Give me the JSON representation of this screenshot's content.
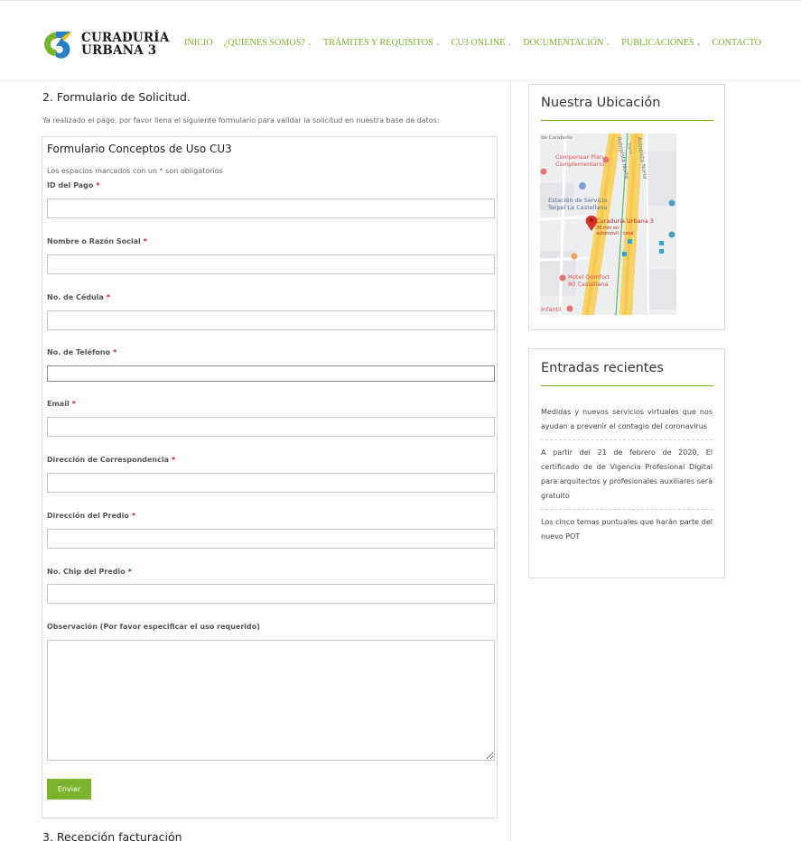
{
  "brand": {
    "name_line1": "CURADURÍA",
    "name_line2": "URBANA 3",
    "accent": "#7cb32c",
    "blue": "#2a7fc7",
    "yellow": "#f2c500"
  },
  "nav": {
    "items": [
      {
        "label": "INICIO",
        "has_dropdown": false
      },
      {
        "label": "¿QUIENES SOMOS?",
        "has_dropdown": true
      },
      {
        "label": "TRÁMITES Y REQUISITOS",
        "has_dropdown": true
      },
      {
        "label": "CU3 ONLINE",
        "has_dropdown": true
      },
      {
        "label": "DOCUMENTACIÓN",
        "has_dropdown": true
      },
      {
        "label": "PUBLICACIONES",
        "has_dropdown": true
      },
      {
        "label": "CONTACTO",
        "has_dropdown": false
      }
    ],
    "dropdown_glyph": "⌄"
  },
  "main": {
    "section_title": "2. Formulario de Solicitud.",
    "section_desc": "Ya realizado el pago, por favor llena el siguiente formulario para validar la solicitud en nuestra base de datos:",
    "next_section_title": "3. Recepción facturación"
  },
  "form": {
    "title": "Formulario Conceptos de Uso CU3",
    "required_note": "Los espacios marcados con un * son obligatorios",
    "required_mark": "*",
    "fields": [
      {
        "label": "ID del Pago",
        "value": ""
      },
      {
        "label": "Nombre o Razón Social",
        "value": ""
      },
      {
        "label": "No. de Cédula",
        "value": ""
      },
      {
        "label": "No. de Teléfono",
        "value": ""
      },
      {
        "label": "Email",
        "value": ""
      },
      {
        "label": "Dirección de Correspondencia",
        "value": ""
      },
      {
        "label": "Dirección del Predio",
        "value": ""
      },
      {
        "label": "No. Chip del Predio",
        "value": ""
      }
    ],
    "observation_label": "Observación (Por favor especificar el uso requerido)",
    "observation_value": "",
    "submit_label": "Enviar"
  },
  "sidebar": {
    "location_title": "Nuestra Ubicación",
    "map": {
      "labels": {
        "top": "de Carabelle",
        "compensar_1": "Compensar Plan",
        "compensar_2": "Complementario",
        "estacion_1": "Estación de Servicio",
        "estacion_2": "Terpel La Castellana",
        "cu3_1": "Curaduria Urbana 3",
        "cu3_2": "30 min en",
        "cu3_3": "automóvil - casa",
        "hotel_1": "Hotel Qomfort",
        "hotel_2": "80 Castellana",
        "infantil": "Infantil",
        "road_1": "Autopista Norte",
        "road_2": "Autopista Norte",
        "road_small": "Trans"
      }
    },
    "recent_title": "Entradas recientes",
    "recent_posts": [
      "Medidas y nuevos servicios virtuales que nos ayudan a prevenir el contagio del coronavirus",
      "A partir del 21 de febrero de 2020, El certificado de de Vigencia Profesional Digital para arquitectos y profesionales auxiliares será gratuito",
      "Los cinco temas puntuales que harán parte del nuevo POT"
    ]
  }
}
